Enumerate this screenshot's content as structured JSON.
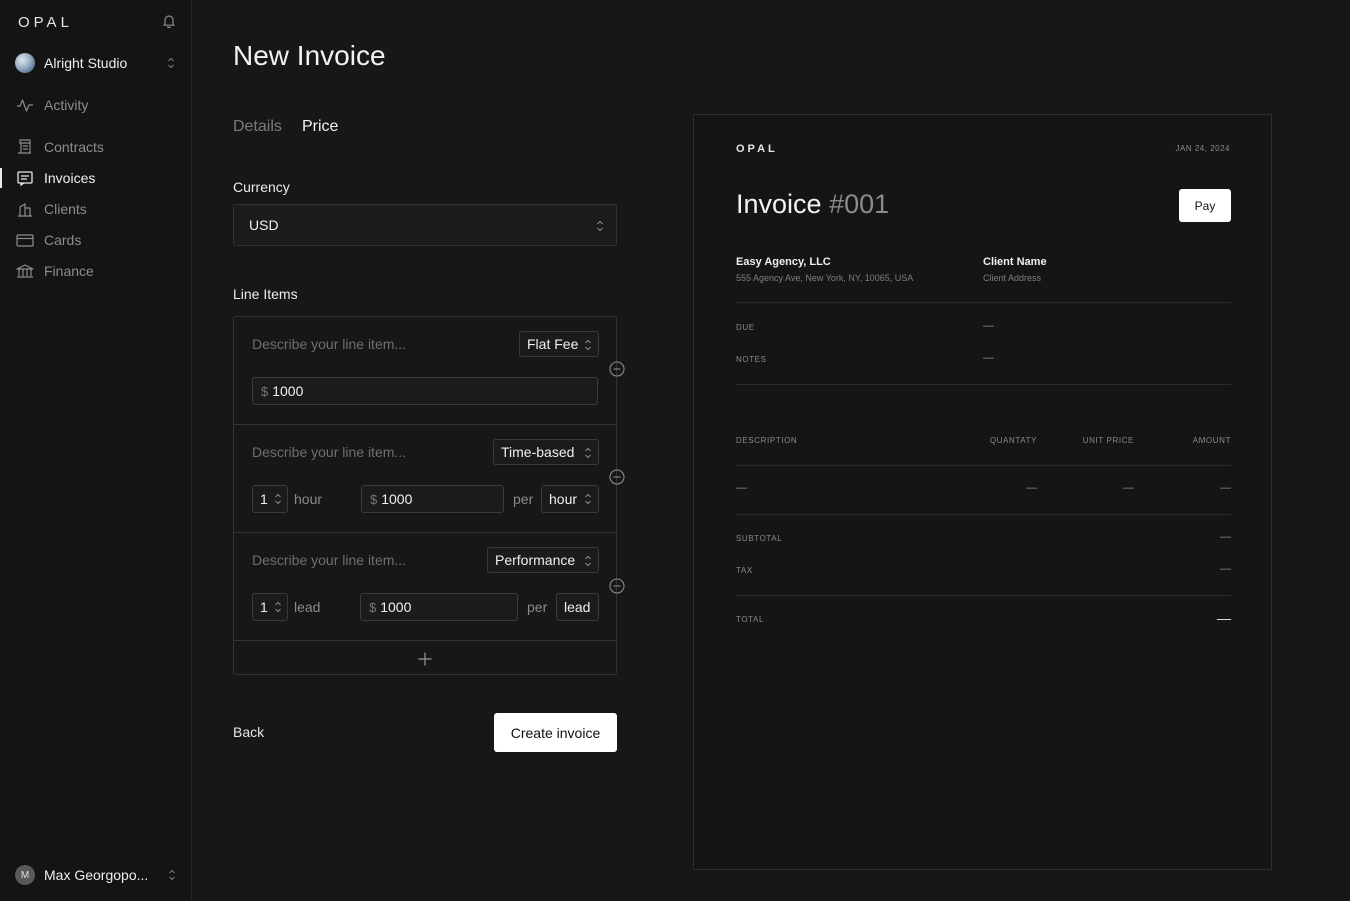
{
  "sidebar": {
    "logo": "OPAL",
    "workspace": "Alright Studio",
    "items": [
      {
        "label": "Activity"
      },
      {
        "label": "Contracts"
      },
      {
        "label": "Invoices"
      },
      {
        "label": "Clients"
      },
      {
        "label": "Cards"
      },
      {
        "label": "Finance"
      }
    ],
    "user": {
      "initial": "M",
      "name": "Max Georgopo..."
    }
  },
  "main": {
    "title": "New Invoice",
    "tabs": [
      {
        "label": "Details"
      },
      {
        "label": "Price"
      }
    ],
    "currency_label": "Currency",
    "currency_value": "USD",
    "line_items_label": "Line Items",
    "line_items": [
      {
        "placeholder": "Describe your line item...",
        "type": "Flat Fee",
        "currency_symbol": "$",
        "amount": "1000"
      },
      {
        "placeholder": "Describe your line item...",
        "type": "Time-based",
        "quantity": "1",
        "unit": "hour",
        "currency_symbol": "$",
        "amount": "1000",
        "per": "per",
        "per_unit": "hour"
      },
      {
        "placeholder": "Describe your line item...",
        "type": "Performance",
        "quantity": "1",
        "unit": "lead",
        "currency_symbol": "$",
        "amount": "1000",
        "per": "per",
        "per_unit": "lead"
      }
    ],
    "back_label": "Back",
    "create_label": "Create invoice"
  },
  "preview": {
    "logo": "OPAL",
    "date": "JAN 24, 2024",
    "title": "Invoice",
    "number": "#001",
    "pay_label": "Pay",
    "from": {
      "name": "Easy Agency, LLC",
      "address": "555 Agency Ave, New York, NY, 10065, USA"
    },
    "to": {
      "name": "Client Name",
      "address": "Client Address"
    },
    "due_label": "DUE",
    "due_value": "—",
    "notes_label": "NOTES",
    "notes_value": "—",
    "columns": [
      "DESCRIPTION",
      "QUANTATY",
      "UNIT PRICE",
      "AMOUNT"
    ],
    "row": [
      "—",
      "—",
      "—",
      "—"
    ],
    "subtotal_label": "SUBTOTAL",
    "subtotal_value": "—",
    "tax_label": "TAX",
    "tax_value": "—",
    "total_label": "TOTAL",
    "total_value": "—"
  }
}
